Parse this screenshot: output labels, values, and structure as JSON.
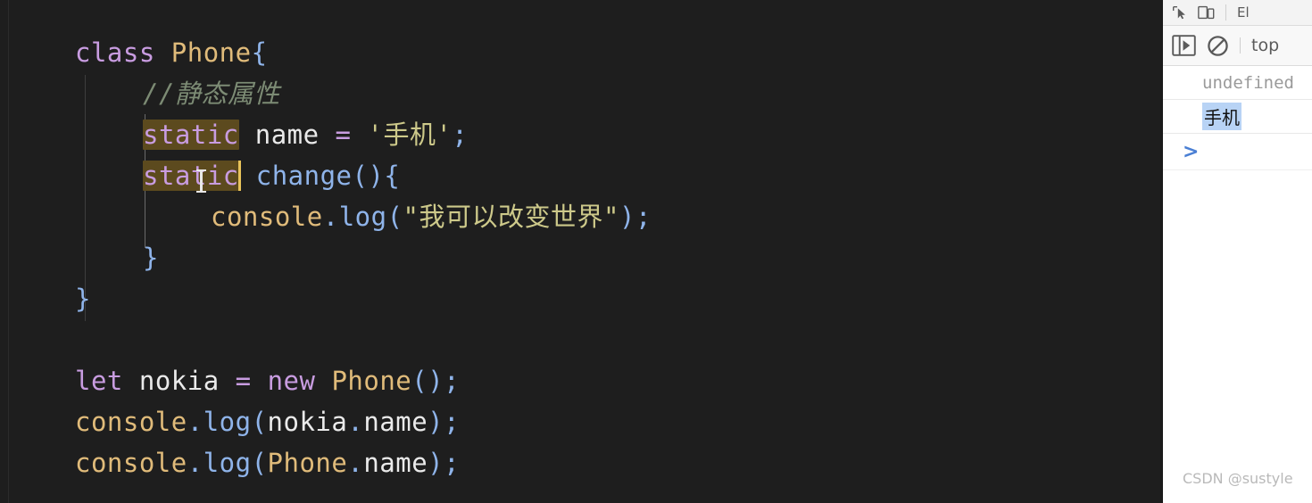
{
  "editor": {
    "language": "javascript",
    "code_lines": [
      {
        "indent": 0,
        "tokens": [
          {
            "t": "class",
            "c": "kw"
          },
          {
            "t": " ",
            "c": "plain"
          },
          {
            "t": "Phone",
            "c": "cls"
          },
          {
            "t": "{",
            "c": "punc"
          }
        ]
      },
      {
        "indent": 1,
        "tokens": [
          {
            "t": "//静态属性",
            "c": "cmt"
          }
        ]
      },
      {
        "indent": 1,
        "tokens": [
          {
            "t": "static",
            "c": "kw hl"
          },
          {
            "t": " ",
            "c": "plain"
          },
          {
            "t": "name",
            "c": "plain"
          },
          {
            "t": " ",
            "c": "plain"
          },
          {
            "t": "=",
            "c": "op"
          },
          {
            "t": " ",
            "c": "plain"
          },
          {
            "t": "'手机'",
            "c": "str"
          },
          {
            "t": ";",
            "c": "punc"
          }
        ]
      },
      {
        "indent": 1,
        "tokens": [
          {
            "t": "static",
            "c": "kw hl"
          },
          {
            "t": "CARET",
            "c": "caret"
          },
          {
            "t": " ",
            "c": "plain"
          },
          {
            "t": "change",
            "c": "fn"
          },
          {
            "t": "()",
            "c": "punc"
          },
          {
            "t": "{",
            "c": "punc"
          }
        ]
      },
      {
        "indent": 2,
        "tokens": [
          {
            "t": "console",
            "c": "obj"
          },
          {
            "t": ".",
            "c": "punc"
          },
          {
            "t": "log",
            "c": "fn"
          },
          {
            "t": "(",
            "c": "punc"
          },
          {
            "t": "\"我可以改变世界\"",
            "c": "str"
          },
          {
            "t": ")",
            "c": "punc"
          },
          {
            "t": ";",
            "c": "punc"
          }
        ]
      },
      {
        "indent": 1,
        "tokens": [
          {
            "t": "}",
            "c": "punc"
          }
        ]
      },
      {
        "indent": 0,
        "tokens": [
          {
            "t": "}",
            "c": "punc"
          }
        ]
      },
      {
        "indent": 0,
        "tokens": []
      },
      {
        "indent": 0,
        "tokens": [
          {
            "t": "let",
            "c": "kw"
          },
          {
            "t": " ",
            "c": "plain"
          },
          {
            "t": "nokia",
            "c": "plain"
          },
          {
            "t": " ",
            "c": "plain"
          },
          {
            "t": "=",
            "c": "op"
          },
          {
            "t": " ",
            "c": "plain"
          },
          {
            "t": "new",
            "c": "kw"
          },
          {
            "t": " ",
            "c": "plain"
          },
          {
            "t": "Phone",
            "c": "cls"
          },
          {
            "t": "()",
            "c": "punc"
          },
          {
            "t": ";",
            "c": "punc"
          }
        ]
      },
      {
        "indent": 0,
        "tokens": [
          {
            "t": "console",
            "c": "obj"
          },
          {
            "t": ".",
            "c": "punc"
          },
          {
            "t": "log",
            "c": "fn"
          },
          {
            "t": "(",
            "c": "punc"
          },
          {
            "t": "nokia",
            "c": "plain"
          },
          {
            "t": ".",
            "c": "punc"
          },
          {
            "t": "name",
            "c": "plain"
          },
          {
            "t": ")",
            "c": "punc"
          },
          {
            "t": ";",
            "c": "punc"
          }
        ]
      },
      {
        "indent": 0,
        "tokens": [
          {
            "t": "console",
            "c": "obj"
          },
          {
            "t": ".",
            "c": "punc"
          },
          {
            "t": "log",
            "c": "fn"
          },
          {
            "t": "(",
            "c": "punc"
          },
          {
            "t": "Phone",
            "c": "cls"
          },
          {
            "t": ".",
            "c": "punc"
          },
          {
            "t": "name",
            "c": "plain"
          },
          {
            "t": ")",
            "c": "punc"
          },
          {
            "t": ";",
            "c": "punc"
          }
        ]
      }
    ],
    "colors": {
      "background": "#1e1e1e",
      "keyword": "#c89ce0",
      "class_name": "#e0bb7a",
      "function": "#8fb4ea",
      "string": "#cdc98a",
      "comment": "#7c8b74",
      "identifier": "#eaeaea",
      "occurrence_highlight": "#5c4a1e",
      "caret": "#e8c35a"
    }
  },
  "devtools": {
    "toolbar_top": {
      "inspect_icon": "inspect-element-icon",
      "device_icon": "device-toolbar-icon",
      "tab_label": "El"
    },
    "toolbar_console": {
      "sidebar_icon": "console-sidebar-icon",
      "clear_icon": "clear-console-icon",
      "context_label": "top"
    },
    "console_rows": [
      {
        "value": "undefined",
        "kind": "undefined",
        "selected": false
      },
      {
        "value": "手机",
        "kind": "log",
        "selected": true
      }
    ],
    "prompt_symbol": ">",
    "colors": {
      "panel_bg": "#ffffff",
      "toolbar_bg": "#f3f3f3",
      "undefined_text": "#9a9a9a",
      "selection": "#b8d3f5",
      "prompt": "#4a7fd4"
    }
  },
  "watermark": {
    "text": "CSDN @sustyle"
  }
}
